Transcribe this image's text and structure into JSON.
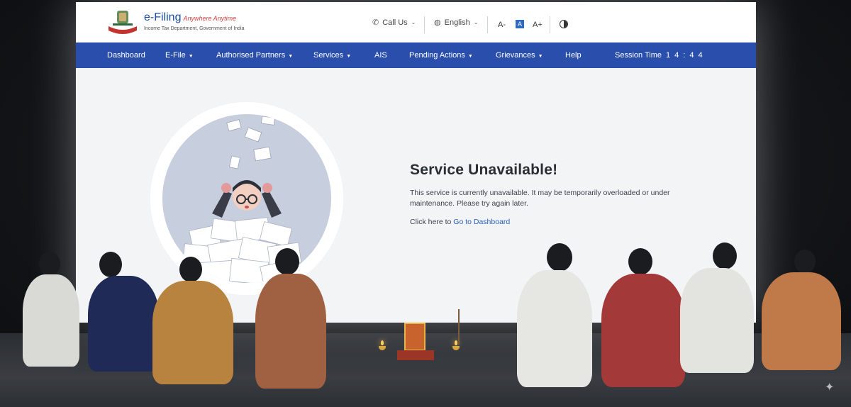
{
  "header": {
    "logo_title": "e-Filing",
    "logo_tagline": "Anywhere Anytime",
    "logo_subtitle": "Income Tax Department, Government of India",
    "call_us": "Call Us",
    "language": "English",
    "font_decrease": "A-",
    "font_normal": "A",
    "font_increase": "A+"
  },
  "nav": {
    "items": [
      {
        "label": "Dashboard",
        "has_dropdown": false
      },
      {
        "label": "E-File",
        "has_dropdown": true
      },
      {
        "label": "Authorised Partners",
        "has_dropdown": true
      },
      {
        "label": "Services",
        "has_dropdown": true
      },
      {
        "label": "AIS",
        "has_dropdown": false
      },
      {
        "label": "Pending Actions",
        "has_dropdown": true
      },
      {
        "label": "Grievances",
        "has_dropdown": true
      },
      {
        "label": "Help",
        "has_dropdown": false
      }
    ],
    "session_label": "Session Time",
    "session_value": "14:44"
  },
  "main": {
    "title": "Service Unavailable!",
    "body": "This service is currently unavailable. It may be temporarily overloaded or under maintenance. Please try again later.",
    "link_prefix": "Click here to",
    "link_text": "Go to Dashboard"
  },
  "colors": {
    "nav_bg": "#2a4eac",
    "link": "#2a5fb8",
    "page_bg": "#f3f4f6"
  },
  "icons": [
    "phone-icon",
    "globe-icon",
    "contrast-icon",
    "chevron-down-icon",
    "sparkle-icon"
  ]
}
